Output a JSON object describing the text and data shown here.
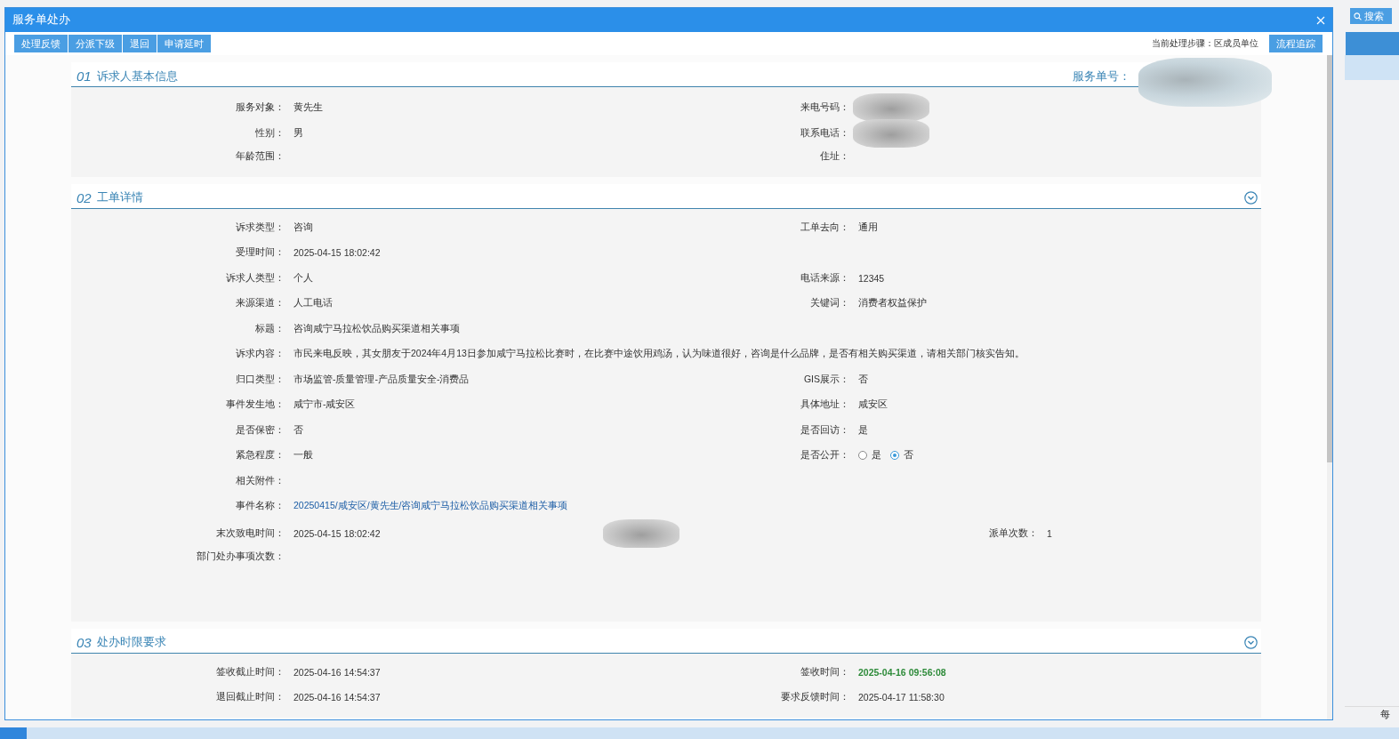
{
  "window": {
    "title": "服务单处办"
  },
  "toolbar": {
    "buttons": [
      "处理反馈",
      "分派下级",
      "退回",
      "申请延时"
    ],
    "step_label": "当前处理步骤：区成员单位",
    "trace_button": "流程追踪"
  },
  "sections": [
    {
      "number": "01",
      "title": "诉求人基本信息",
      "service_number": {
        "label": "服务单号：",
        "redacted": true
      },
      "rows": [
        [
          {
            "kind": "text",
            "label": "服务对象：",
            "value": "黄先生"
          },
          {
            "kind": "redacted",
            "label": "来电号码："
          }
        ],
        [
          {
            "kind": "text",
            "label": "性别：",
            "value": "男"
          },
          {
            "kind": "redacted",
            "label": "联系电话："
          }
        ],
        [
          {
            "kind": "text",
            "label": "年龄范围："
          },
          {
            "kind": "text",
            "label": "住址："
          }
        ]
      ]
    },
    {
      "number": "02",
      "title": "工单详情",
      "expanded": true,
      "rows": [
        [
          {
            "kind": "text",
            "label": "诉求类型：",
            "value": "咨询"
          },
          {
            "kind": "text",
            "label": "工单去向：",
            "value": "通用"
          }
        ],
        [
          {
            "kind": "text",
            "label": "受理时间：",
            "value": "2025-04-15 18:02:42"
          }
        ],
        [
          {
            "kind": "text",
            "label": "诉求人类型：",
            "value": "个人"
          },
          {
            "kind": "text",
            "label": "电话来源：",
            "value": "12345"
          }
        ],
        [
          {
            "kind": "text",
            "label": "来源渠道：",
            "value": "人工电话"
          },
          {
            "kind": "text",
            "label": "关键词：",
            "value": "消费者权益保护"
          }
        ],
        [
          {
            "kind": "text",
            "label": "标题：",
            "value": "咨询咸宁马拉松饮品购买渠道相关事项"
          }
        ],
        [
          {
            "kind": "text",
            "label": "诉求内容：",
            "value": "市民来电反映，其女朋友于2024年4月13日参加咸宁马拉松比赛时，在比赛中途饮用鸡汤，认为味道很好，咨询是什么品牌，是否有相关购买渠道，请相关部门核实告知。"
          }
        ],
        [
          {
            "kind": "text",
            "label": "归口类型：",
            "value": "市场监管-质量管理-产品质量安全-消费品"
          },
          {
            "kind": "text",
            "label": "GIS展示：",
            "value": "否"
          }
        ],
        [
          {
            "kind": "text",
            "label": "事件发生地：",
            "value": "咸宁市-咸安区"
          },
          {
            "kind": "text",
            "label": "具体地址：",
            "value": "咸安区"
          }
        ],
        [
          {
            "kind": "text",
            "label": "是否保密：",
            "value": "否"
          },
          {
            "kind": "text",
            "label": "是否回访：",
            "value": "是"
          }
        ],
        [
          {
            "kind": "text",
            "label": "紧急程度：",
            "value": "一般"
          },
          {
            "kind": "radio",
            "label": "是否公开：",
            "options": [
              {
                "label": "是",
                "selected": false
              },
              {
                "label": "否",
                "selected": true
              }
            ]
          }
        ],
        [
          {
            "kind": "text",
            "label": "相关附件："
          }
        ],
        [
          {
            "kind": "link",
            "label": "事件名称：",
            "value": "20250415/咸安区/黄先生/咨询咸宁马拉松饮品购买渠道相关事项"
          }
        ],
        [
          {
            "kind": "text",
            "label": "末次致电时间：",
            "value": "2025-04-15 18:02:42"
          },
          {
            "kind": "redacted"
          },
          {
            "kind": "text",
            "label": "派单次数：",
            "value": "1"
          }
        ],
        [
          {
            "kind": "text",
            "label": "部门处办事项次数："
          }
        ]
      ]
    },
    {
      "number": "03",
      "title": "处办时限要求",
      "expanded": true,
      "rows": [
        [
          {
            "kind": "text",
            "label": "签收截止时间：",
            "value": "2025-04-16 14:54:37"
          },
          {
            "kind": "highlight",
            "label": "签收时间：",
            "value": "2025-04-16 09:56:08"
          }
        ],
        [
          {
            "kind": "text",
            "label": "退回截止时间：",
            "value": "2025-04-16 14:54:37"
          },
          {
            "kind": "text",
            "label": "要求反馈时间：",
            "value": "2025-04-17 11:58:30"
          }
        ]
      ]
    }
  ],
  "background_page": {
    "search_button": "搜索",
    "footer_text": "每"
  }
}
